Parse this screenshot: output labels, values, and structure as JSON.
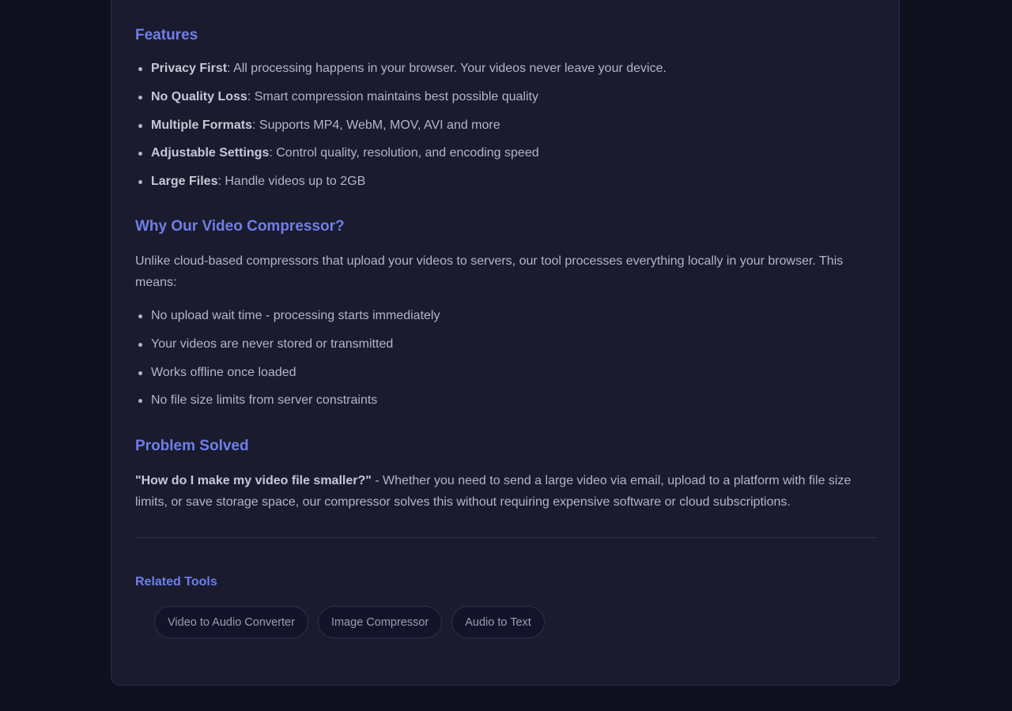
{
  "features": {
    "heading": "Features",
    "items": [
      {
        "title": "Privacy First",
        "text": ": All processing happens in your browser. Your videos never leave your device."
      },
      {
        "title": "No Quality Loss",
        "text": ": Smart compression maintains best possible quality"
      },
      {
        "title": "Multiple Formats",
        "text": ": Supports MP4, WebM, MOV, AVI and more"
      },
      {
        "title": "Adjustable Settings",
        "text": ": Control quality, resolution, and encoding speed"
      },
      {
        "title": "Large Files",
        "text": ": Handle videos up to 2GB"
      }
    ]
  },
  "why": {
    "heading": "Why Our Video Compressor?",
    "intro": "Unlike cloud-based compressors that upload your videos to servers, our tool processes everything locally in your browser. This means:",
    "items": [
      "No upload wait time - processing starts immediately",
      "Your videos are never stored or transmitted",
      "Works offline once loaded",
      "No file size limits from server constraints"
    ]
  },
  "problem": {
    "heading": "Problem Solved",
    "question": "\"How do I make my video file smaller?\"",
    "text": " - Whether you need to send a large video via email, upload to a platform with file size limits, or save storage space, our compressor solves this without requiring expensive software or cloud subscriptions."
  },
  "related": {
    "heading": "Related Tools",
    "tools": [
      "Video to Audio Converter",
      "Image Compressor",
      "Audio to Text"
    ]
  },
  "colors": {
    "background": "#0f0f1e",
    "card": "#1a1b2e",
    "accent": "#6f7fe8",
    "text": "#b4b6c6"
  }
}
